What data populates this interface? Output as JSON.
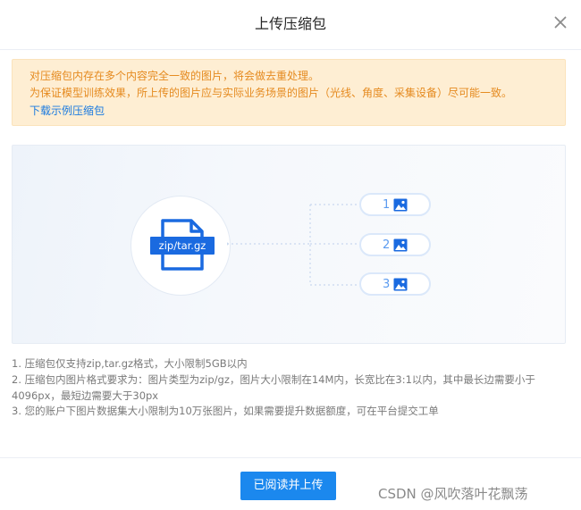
{
  "dialog": {
    "title": "上传压缩包"
  },
  "notice": {
    "line1": "对压缩包内存在多个内容完全一致的图片，将会做去重处理。",
    "line2": "为保证模型训练效果，所上传的图片应与实际业务场景的图片（光线、角度、采集设备）尽可能一致。",
    "link": "下载示例压缩包",
    "colors": {
      "text": "#e58a1f",
      "link": "#1a7ae0",
      "background": "#feeed3"
    }
  },
  "illustration": {
    "file_label": "zip/tar.gz",
    "items": [
      {
        "number": "1",
        "icon": "image-icon"
      },
      {
        "number": "2",
        "icon": "image-icon"
      },
      {
        "number": "3",
        "icon": "image-icon"
      }
    ],
    "colors": {
      "file": "#1a6ae0",
      "pill_number": "#5b9bf0"
    }
  },
  "requirements": [
    "1. 压缩包仅支持zip,tar.gz格式，大小限制5GB以内",
    "2. 压缩包内图片格式要求为：图片类型为zip/gz，图片大小限制在14M内，长宽比在3:1以内，其中最长边需要小于4096px，最短边需要大于30px",
    "3. 您的账户下图片数据集大小限制为10万张图片，如果需要提升数据额度，可在平台提交工单"
  ],
  "footer": {
    "primary_button": "已阅读并上传",
    "watermark": "CSDN @风吹落叶花飘荡",
    "colors": {
      "primary": "#1b88ee"
    }
  }
}
